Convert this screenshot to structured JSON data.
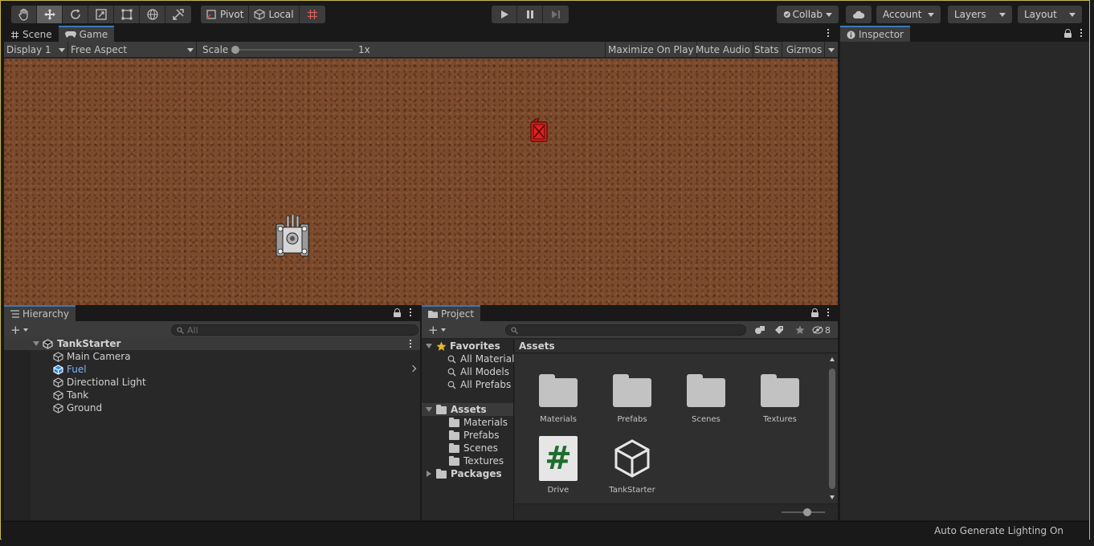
{
  "toolbar": {
    "pivot_label": "Pivot",
    "local_label": "Local",
    "collab_label": "Collab",
    "account_label": "Account",
    "layers_label": "Layers",
    "layout_label": "Layout"
  },
  "game_panel": {
    "tabs": [
      "Scene",
      "Game"
    ],
    "display_label": "Display 1",
    "aspect_label": "Free Aspect",
    "scale_label": "Scale",
    "scale_value": "1x",
    "scale_fraction": 0.0,
    "maximize_label": "Maximize On Play",
    "mute_label": "Mute Audio",
    "stats_label": "Stats",
    "gizmos_label": "Gizmos"
  },
  "inspector": {
    "title": "Inspector"
  },
  "hierarchy": {
    "title": "Hierarchy",
    "search_placeholder": "All",
    "scene_name": "TankStarter",
    "items": [
      {
        "label": "Main Camera",
        "selected": false
      },
      {
        "label": "Fuel",
        "selected": true
      },
      {
        "label": "Directional Light",
        "selected": false
      },
      {
        "label": "Tank",
        "selected": false
      },
      {
        "label": "Ground",
        "selected": false
      }
    ]
  },
  "project": {
    "title": "Project",
    "hidden_count": "8",
    "favorites": {
      "label": "Favorites",
      "items": [
        "All Materials",
        "All Models",
        "All Prefabs"
      ]
    },
    "assets_tree": {
      "label": "Assets",
      "items": [
        "Materials",
        "Prefabs",
        "Scenes",
        "Textures"
      ]
    },
    "packages_label": "Packages",
    "breadcrumb": "Assets",
    "grid_items": [
      {
        "label": "Materials",
        "icon": "folder-icon"
      },
      {
        "label": "Prefabs",
        "icon": "folder-icon"
      },
      {
        "label": "Scenes",
        "icon": "folder-icon"
      },
      {
        "label": "Textures",
        "icon": "folder-icon"
      },
      {
        "label": "Drive",
        "icon": "csharp-script-icon"
      },
      {
        "label": "TankStarter",
        "icon": "unity-scene-icon"
      }
    ]
  },
  "status": {
    "text": "Auto Generate Lighting On"
  },
  "colors": {
    "accent": "#3a79bb",
    "selected_text": "#7cb3f5",
    "ground": "#7c4a2c",
    "fuel": "#e0201e",
    "script_hash": "#1e6e2e"
  }
}
